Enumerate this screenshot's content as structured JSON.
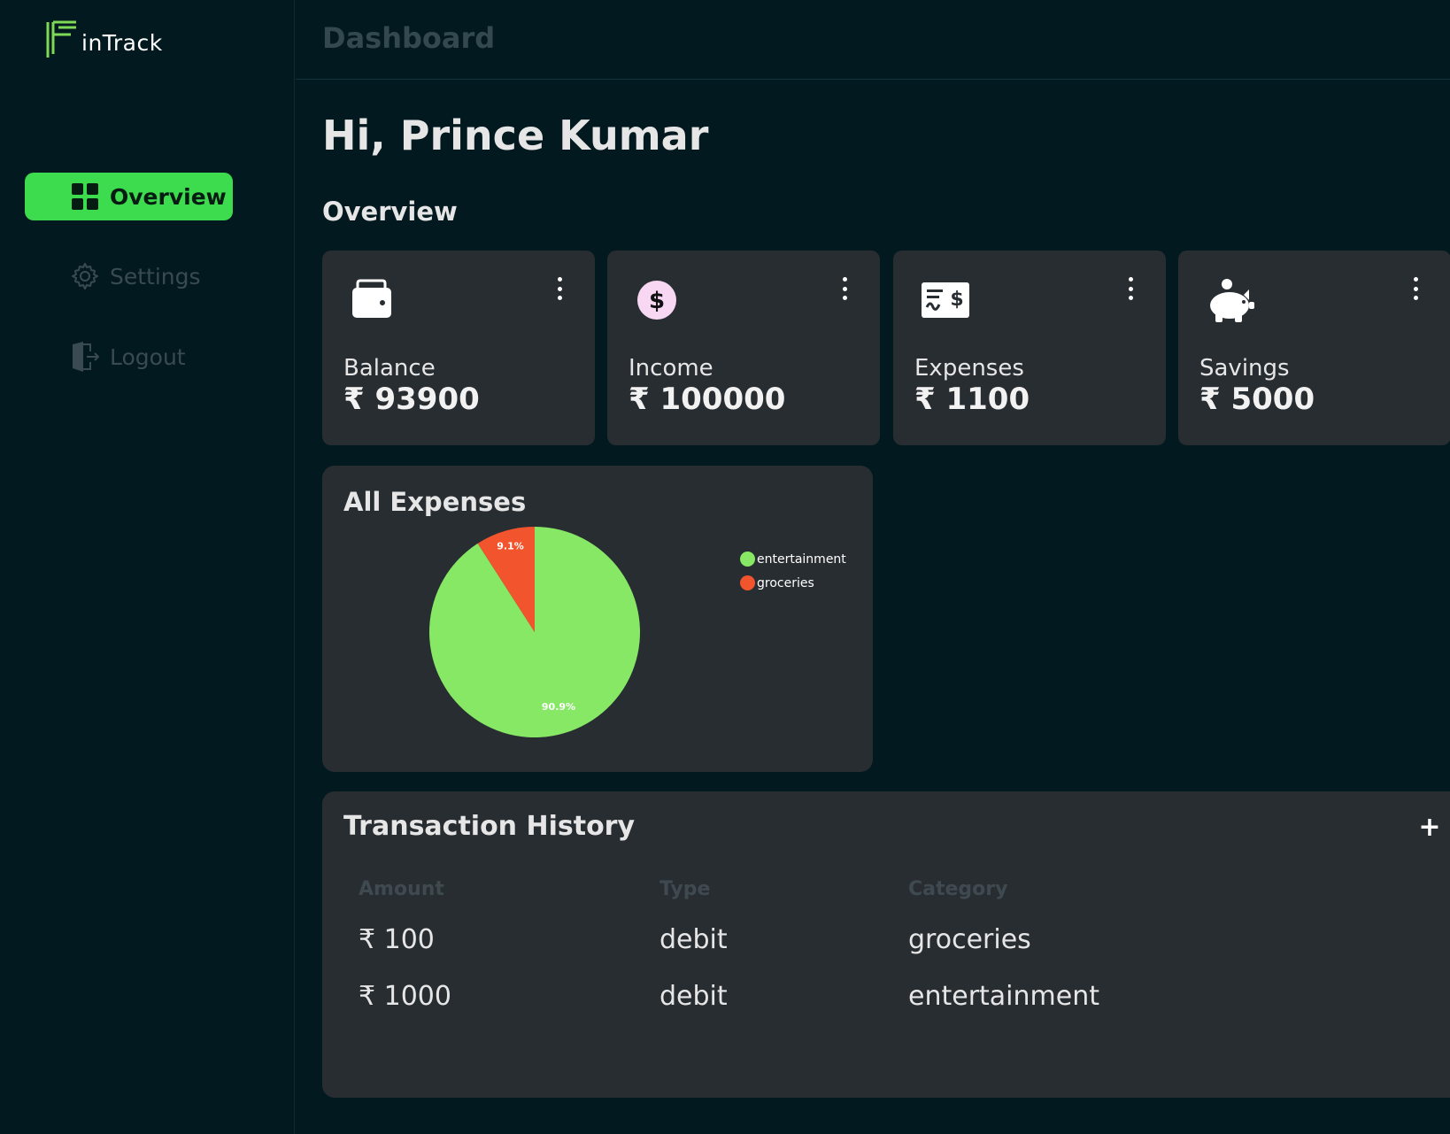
{
  "app": {
    "logo_letter": "F",
    "logo_text": "inTrack",
    "accent_color": "#3ddc4f"
  },
  "sidebar": {
    "items": [
      {
        "label": "Overview",
        "icon": "grid-icon",
        "active": true
      },
      {
        "label": "Settings",
        "icon": "gear-icon",
        "active": false
      },
      {
        "label": "Logout",
        "icon": "logout-door-icon",
        "active": false
      }
    ]
  },
  "header": {
    "title": "Dashboard"
  },
  "main": {
    "greeting": "Hi, Prince Kumar",
    "section_title": "Overview",
    "cards": [
      {
        "label": "Balance",
        "value": "₹ 93900",
        "icon": "wallet-icon"
      },
      {
        "label": "Income",
        "value": "₹ 100000",
        "icon": "dollar-coin-icon"
      },
      {
        "label": "Expenses",
        "value": "₹ 1100",
        "icon": "cheque-icon"
      },
      {
        "label": "Savings",
        "value": "₹ 5000",
        "icon": "piggy-bank-icon"
      }
    ]
  },
  "chart_data": {
    "type": "pie",
    "title": "All Expenses",
    "categories": [
      "entertainment",
      "groceries"
    ],
    "values": [
      1000,
      100
    ],
    "percent_labels": [
      "90.9%",
      "9.1%"
    ],
    "colors": [
      "#86e865",
      "#f2542d"
    ],
    "legend_position": "top-right"
  },
  "transactions": {
    "title": "Transaction History",
    "add_label": "+",
    "columns": [
      "Amount",
      "Type",
      "Category"
    ],
    "rows": [
      {
        "amount": "₹ 100",
        "type": "debit",
        "category": "groceries"
      },
      {
        "amount": "₹ 1000",
        "type": "debit",
        "category": "entertainment"
      }
    ]
  }
}
